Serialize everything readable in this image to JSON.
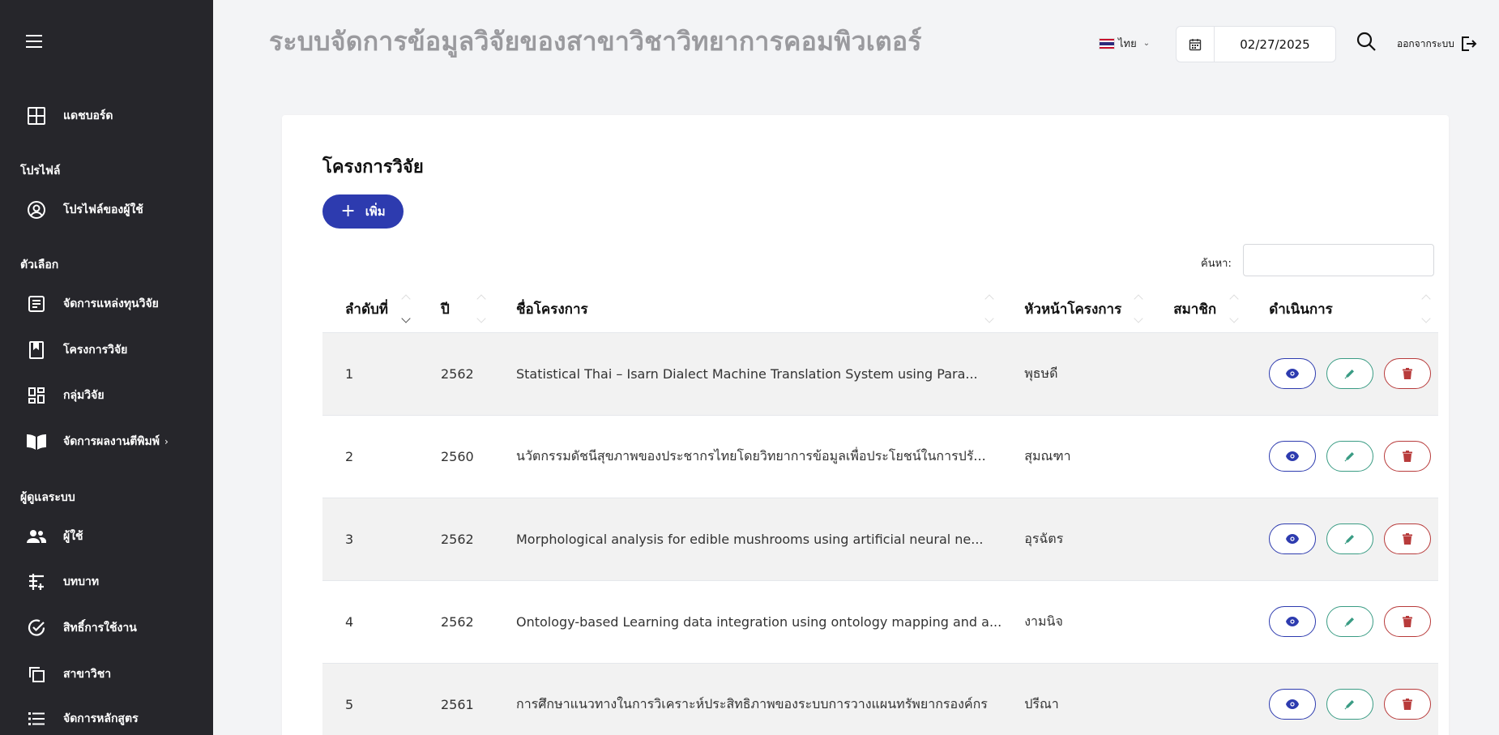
{
  "app": {
    "title": "ระบบจัดการข้อมูลวิจัยของสาขาวิชาวิทยาการคอมพิวเตอร์"
  },
  "sidebar": {
    "dashboard": "แดชบอร์ด",
    "sections": {
      "profile": "โปรไฟล์",
      "options": "ตัวเลือก",
      "admin": "ผู้ดูแลระบบ"
    },
    "items": [
      {
        "label": "โปรไฟล์ของผู้ใช้",
        "icon": "user-circle-icon"
      },
      {
        "label": "จัดการแหล่งทุนวิจัย",
        "icon": "document-icon"
      },
      {
        "label": "โครงการวิจัย",
        "icon": "bookmark-icon"
      },
      {
        "label": "กลุ่มวิจัย",
        "icon": "dashboard-grid-icon"
      },
      {
        "label": "จัดการผลงานตีพิมพ์",
        "icon": "book-open-icon"
      },
      {
        "label": "ผู้ใช้",
        "icon": "users-icon"
      },
      {
        "label": "บทบาท",
        "icon": "roles-icon"
      },
      {
        "label": "สิทธิ์การใช้งาน",
        "icon": "check-badge-icon"
      },
      {
        "label": "สาขาวิชา",
        "icon": "copy-icon"
      },
      {
        "label": "จัดการหลักสูตร",
        "icon": "list-icon"
      }
    ]
  },
  "header": {
    "language": "ไทย",
    "date": "02/27/2025",
    "logout": "ออกจากระบบ"
  },
  "main": {
    "title": "โครงการวิจัย",
    "add_label": "เพิ่ม",
    "search_label": "ค้นหา:",
    "columns": [
      "ลำดับที่",
      "ปี",
      "ชื่อโครงการ",
      "หัวหน้าโครงการ",
      "สมาชิก",
      "ดำเนินการ"
    ],
    "rows": [
      {
        "no": "1",
        "year": "2562",
        "name": "Statistical Thai – Isarn Dialect Machine Translation System using Para...",
        "lead": "พุธษดี",
        "members": ""
      },
      {
        "no": "2",
        "year": "2560",
        "name": "นวัตกรรมดัชนีสุขภาพของประชากรไทยโดยวิทยาการข้อมูลเพื่อประโยชน์ในการปรั...",
        "lead": "สุมณฑา",
        "members": ""
      },
      {
        "no": "3",
        "year": "2562",
        "name": "Morphological analysis for edible mushrooms using artificial neural ne...",
        "lead": "อุรฉัตร",
        "members": ""
      },
      {
        "no": "4",
        "year": "2562",
        "name": "Ontology-based Learning data integration using ontology mapping and a...",
        "lead": "งามนิจ",
        "members": ""
      },
      {
        "no": "5",
        "year": "2561",
        "name": "การศึกษาแนวทางในการวิเคราะห์ประสิทธิภาพของระบบการวางแผนทรัพยากรองค์กร",
        "lead": "ปรีณา",
        "members": ""
      }
    ]
  },
  "colors": {
    "sidebar": "#26262b",
    "primary": "#2d3baf",
    "edit": "#3a9c84",
    "delete": "#b83b3b"
  }
}
